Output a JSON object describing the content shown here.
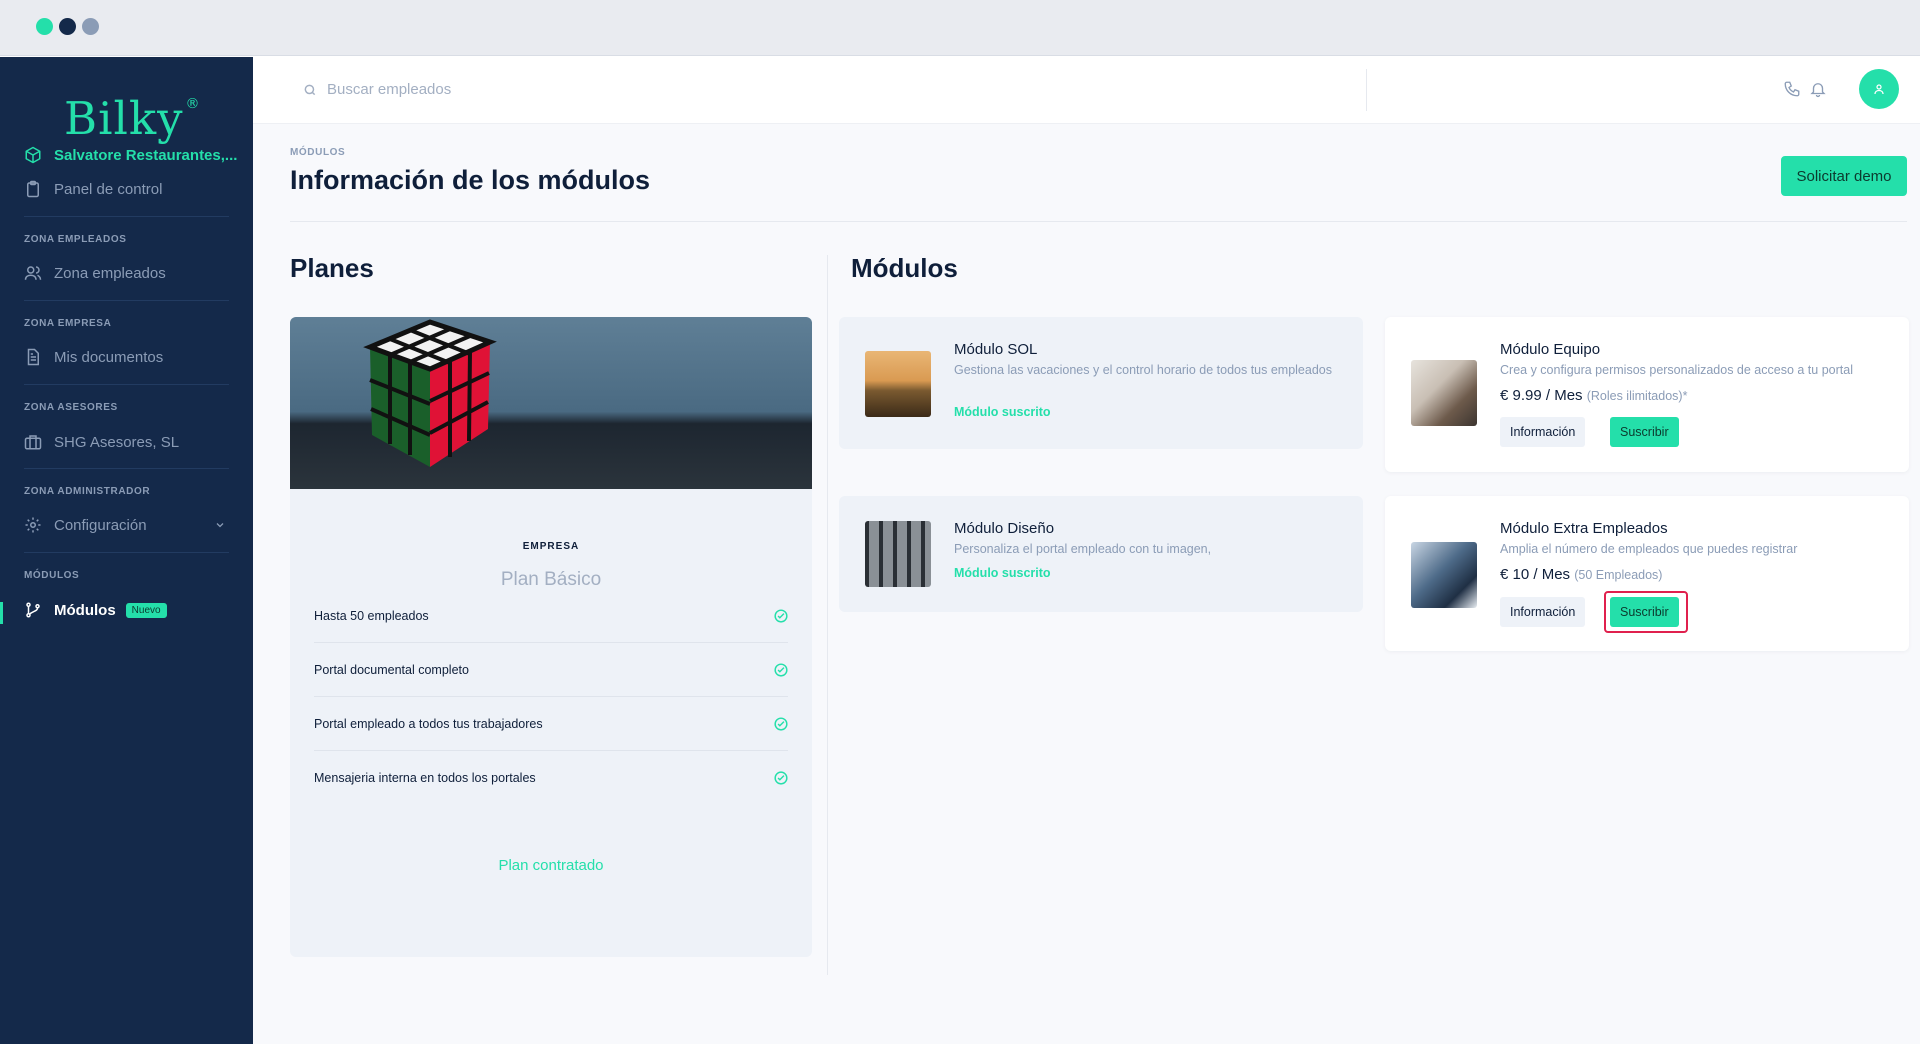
{
  "colors": {
    "accent": "#24dfaa",
    "sidebar_bg": "#14294a",
    "highlight": "#e0204d",
    "dot_1": "#24dfaa",
    "dot_2": "#14294a",
    "dot_3": "#8b9cb6"
  },
  "sidebar": {
    "logo": "Bilky",
    "logo_mark": "®",
    "company": "Salvatore Restaurantes,...",
    "dashboard": "Panel de control",
    "sections": [
      {
        "label": "ZONA EMPLEADOS",
        "item": "Zona empleados"
      },
      {
        "label": "ZONA EMPRESA",
        "item": "Mis documentos"
      },
      {
        "label": "ZONA ASESORES",
        "item": "SHG Asesores, SL"
      },
      {
        "label": "ZONA ADMINISTRADOR",
        "item": "Configuración"
      },
      {
        "label": "MÓDULOS",
        "item": "Módulos",
        "badge": "Nuevo"
      }
    ]
  },
  "topbar": {
    "search_placeholder": "Buscar empleados"
  },
  "page": {
    "breadcrumb": "MÓDULOS",
    "title": "Información de los módulos",
    "demo_button": "Solicitar demo"
  },
  "plans": {
    "heading": "Planes",
    "card": {
      "kind": "EMPRESA",
      "name": "Plan Básico",
      "features": [
        "Hasta 50 empleados",
        "Portal documental completo",
        "Portal empleado a todos tus trabajadores",
        "Mensajeria interna en todos los portales"
      ],
      "status": "Plan contratado"
    }
  },
  "modules": {
    "heading": "Módulos",
    "items": [
      {
        "title": "Módulo SOL",
        "desc": "Gestiona las vacaciones y el control horario de todos tus empleados",
        "status": "Módulo suscrito"
      },
      {
        "title": "Módulo Equipo",
        "desc": "Crea y configura permisos personalizados de acceso a tu portal",
        "price": "€ 9.99 / Mes",
        "price_note": "(Roles ilimitados)*",
        "info_button": "Información",
        "subscribe_button": "Suscribir"
      },
      {
        "title": "Módulo Diseño",
        "desc": "Personaliza el portal empleado con tu imagen,",
        "status": "Módulo suscrito"
      },
      {
        "title": "Módulo Extra Empleados",
        "desc": "Amplia el número de empleados que puedes registrar",
        "price": "€ 10 / Mes",
        "price_note": "(50 Empleados)",
        "info_button": "Información",
        "subscribe_button": "Suscribir"
      }
    ]
  }
}
